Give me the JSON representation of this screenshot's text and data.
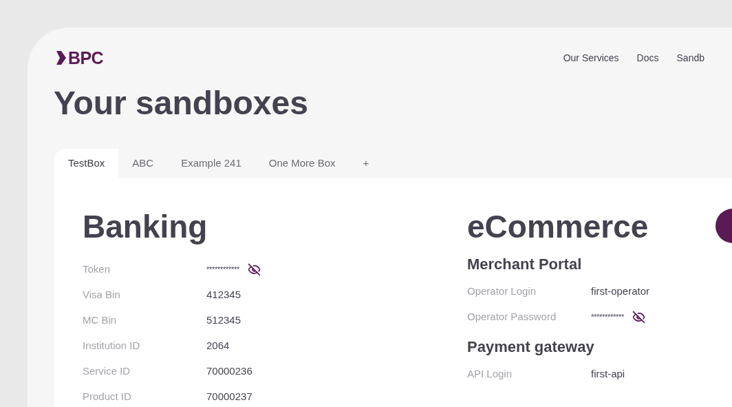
{
  "logo": {
    "text": "BPC"
  },
  "nav": [
    {
      "label": "Our Services"
    },
    {
      "label": "Docs"
    },
    {
      "label": "Sandb"
    }
  ],
  "title": "Your sandboxes",
  "tabs": [
    {
      "label": "TestBox",
      "selected": true
    },
    {
      "label": "ABC",
      "selected": false
    },
    {
      "label": "Example 241",
      "selected": false
    },
    {
      "label": "One More Box",
      "selected": false
    },
    {
      "label": "+",
      "selected": false
    }
  ],
  "banking": {
    "heading": "Banking",
    "rows": [
      {
        "label": "Token",
        "value": "************",
        "kind": "secret"
      },
      {
        "label": "Visa Bin",
        "value": "412345",
        "kind": "plain"
      },
      {
        "label": "MC Bin",
        "value": "512345",
        "kind": "plain"
      },
      {
        "label": "Institution ID",
        "value": "2064",
        "kind": "plain"
      },
      {
        "label": "Service ID",
        "value": "70000236",
        "kind": "plain"
      },
      {
        "label": "Product ID",
        "value": "70000237",
        "kind": "plain"
      }
    ]
  },
  "ecommerce": {
    "heading": "eCommerce",
    "groups": [
      {
        "heading": "Merchant Portal",
        "rows": [
          {
            "label": "Operator Login",
            "value": "first-operator",
            "kind": "plain"
          },
          {
            "label": "Operator Password",
            "value": "************",
            "kind": "secret"
          }
        ]
      },
      {
        "heading": "Payment gateway",
        "rows": [
          {
            "label": "API Login",
            "value": "first-api",
            "kind": "plain"
          }
        ]
      }
    ]
  }
}
